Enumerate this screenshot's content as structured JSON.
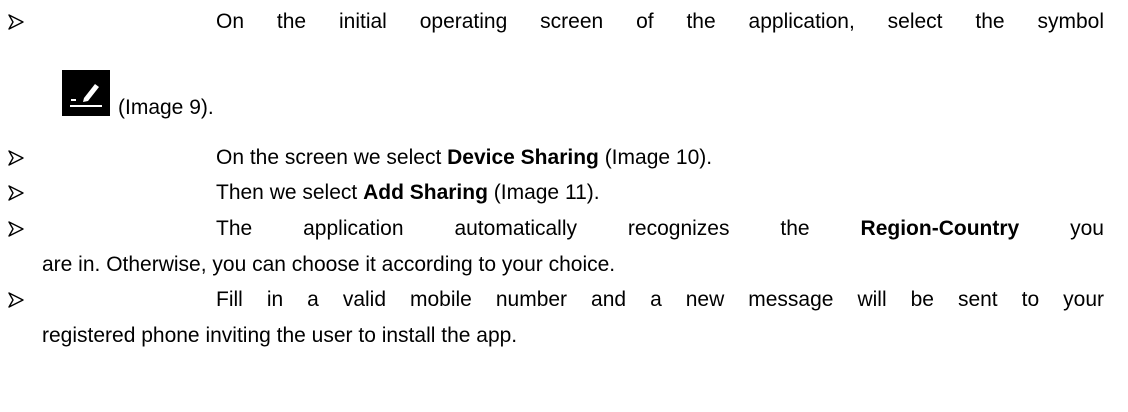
{
  "items": [
    {
      "line1": "On the initial operating screen of the application, select the symbol",
      "after_icon": "(Image 9)."
    },
    {
      "pre": "On the screen we select ",
      "bold": "Device Sharing",
      "post": " (Image 10)."
    },
    {
      "pre": "Then we select ",
      "bold": "Add Sharing",
      "post": " (Image 11)."
    },
    {
      "pre": "The application automatically recognizes the ",
      "bold": "Region-Country",
      "post": " you",
      "line2": "are in. Otherwise, you can choose it according to your choice."
    },
    {
      "line1": "Fill in a valid mobile number and a new message will be sent to your",
      "line2": "registered phone inviting the user to install the app."
    }
  ],
  "icons": {
    "bullet": "arrow-bullet-icon",
    "symbol": "edit-pencil-icon"
  }
}
